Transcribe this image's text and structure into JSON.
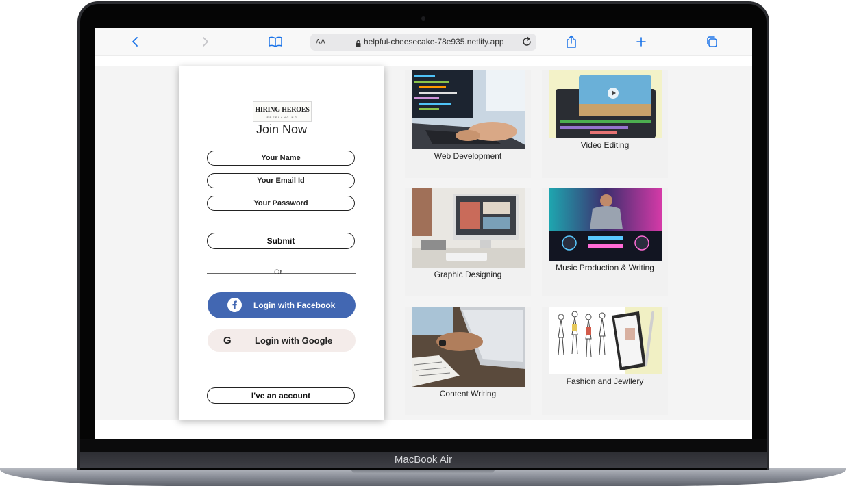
{
  "device": {
    "model_label": "MacBook Air"
  },
  "browser": {
    "aa_label": "AA",
    "url": "helpful-cheesecake-78e935.netlify.app"
  },
  "brand": {
    "logo_main": "HIRING HEROES",
    "logo_sub": "FREELANCING"
  },
  "form": {
    "heading": "Join Now",
    "name_placeholder": "Your Name",
    "email_placeholder": "Your Email Id",
    "password_placeholder": "Your Password",
    "submit_label": "Submit",
    "divider_label": "Or",
    "facebook_label": "Login with Facebook",
    "google_label": "Login with Google",
    "account_label": "I've an account"
  },
  "categories": [
    {
      "label": "Web Development"
    },
    {
      "label": "Video Editing"
    },
    {
      "label": "Graphic Designing"
    },
    {
      "label": "Music Production & Writing"
    },
    {
      "label": "Content Writing"
    },
    {
      "label": "Fashion and Jewllery"
    }
  ],
  "colors": {
    "facebook": "#4267b2",
    "google_bg": "#f4ecea",
    "ios_blue": "#1a73e8"
  }
}
